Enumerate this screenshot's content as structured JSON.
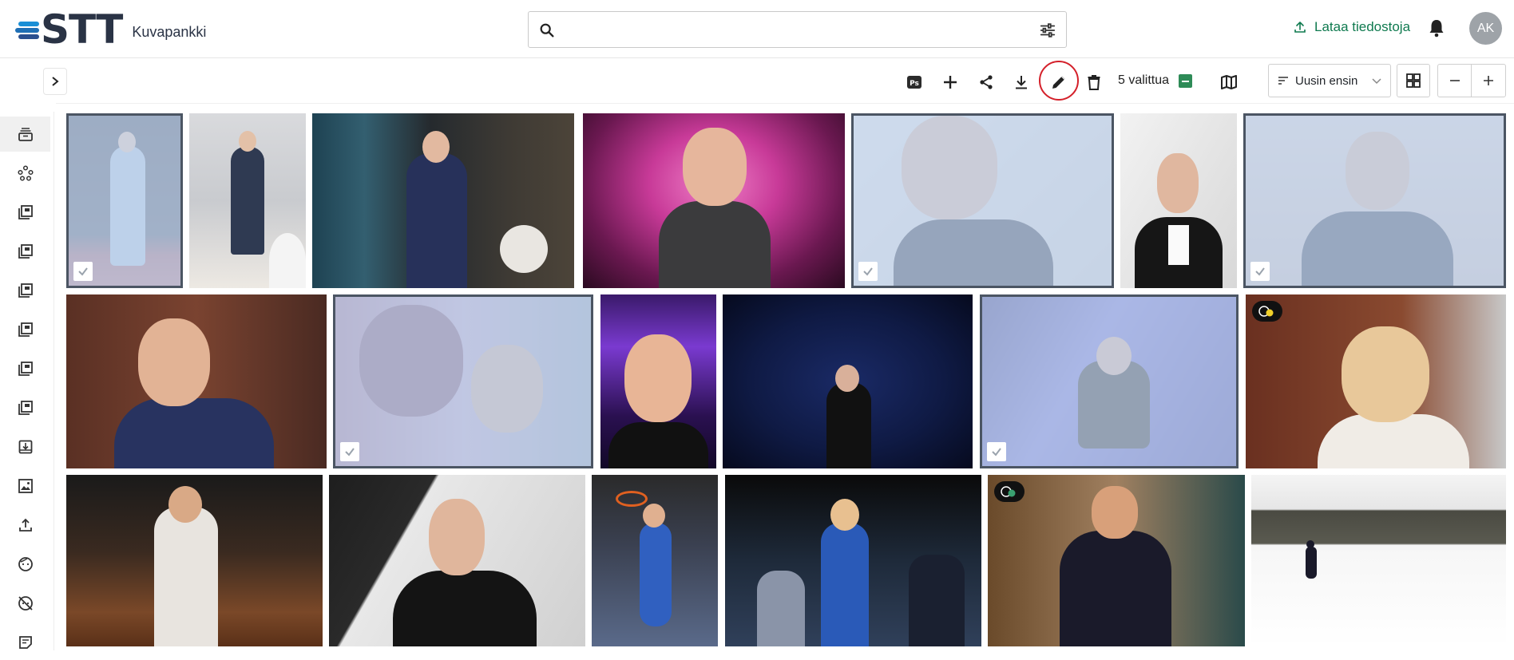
{
  "app": {
    "brand": "STT",
    "subtitle": "Kuvapankki"
  },
  "search": {
    "placeholder": "",
    "value": ""
  },
  "header": {
    "upload_label": "Lataa tiedostoja",
    "avatar_initials": "AK"
  },
  "toolbar": {
    "selected_count_label": "5 valittua",
    "sort_label": "Uusin ensin",
    "actions": [
      "photoshop",
      "add",
      "share",
      "download",
      "edit",
      "delete"
    ],
    "highlighted_action": "edit"
  },
  "sidebar": {
    "icons": [
      "stack-icon",
      "graph-icon",
      "collection-icon",
      "collection-icon",
      "collection-icon",
      "collection-icon",
      "collection-icon",
      "collection-icon",
      "archive-download-icon",
      "image-icon",
      "upload-icon",
      "face-icon",
      "face-off-icon",
      "notes-icon"
    ],
    "active_index": 0
  },
  "gallery": {
    "rows": [
      [
        {
          "subject": "man-light-suit-red-carpet",
          "selected": true
        },
        {
          "subject": "man-blazer-lobby",
          "selected": false
        },
        {
          "subject": "man-navy-suit-restaurant",
          "selected": false
        },
        {
          "subject": "bald-man-pink-chair",
          "selected": false
        },
        {
          "subject": "man-portrait-smile",
          "selected": true
        },
        {
          "subject": "man-tuxedo-bowtie",
          "selected": false
        },
        {
          "subject": "man-suit-arms-crossed",
          "selected": true
        }
      ],
      [
        {
          "subject": "man-suit-wood-panel",
          "selected": false
        },
        {
          "subject": "man-sunglasses-double-exposure",
          "selected": true
        },
        {
          "subject": "man-smile-purple-lights",
          "selected": false
        },
        {
          "subject": "man-stage-audience",
          "selected": false
        },
        {
          "subject": "man-sitting-stage",
          "selected": true
        },
        {
          "subject": "woman-parliament",
          "selected": false,
          "badge": true
        }
      ],
      [
        {
          "subject": "woman-speaking-podium",
          "selected": false
        },
        {
          "subject": "man-tuxedo-grey-wall",
          "selected": false
        },
        {
          "subject": "basketball-layup",
          "selected": false
        },
        {
          "subject": "basketball-player-crowd",
          "selected": false
        },
        {
          "subject": "man-arms-open-studio",
          "selected": false,
          "badge": true
        },
        {
          "subject": "skier-snowy-park",
          "selected": false
        }
      ]
    ]
  },
  "colors": {
    "accent_green": "#0f7a4f",
    "highlight_red": "#d4202a",
    "selection_border": "#4b5563"
  }
}
